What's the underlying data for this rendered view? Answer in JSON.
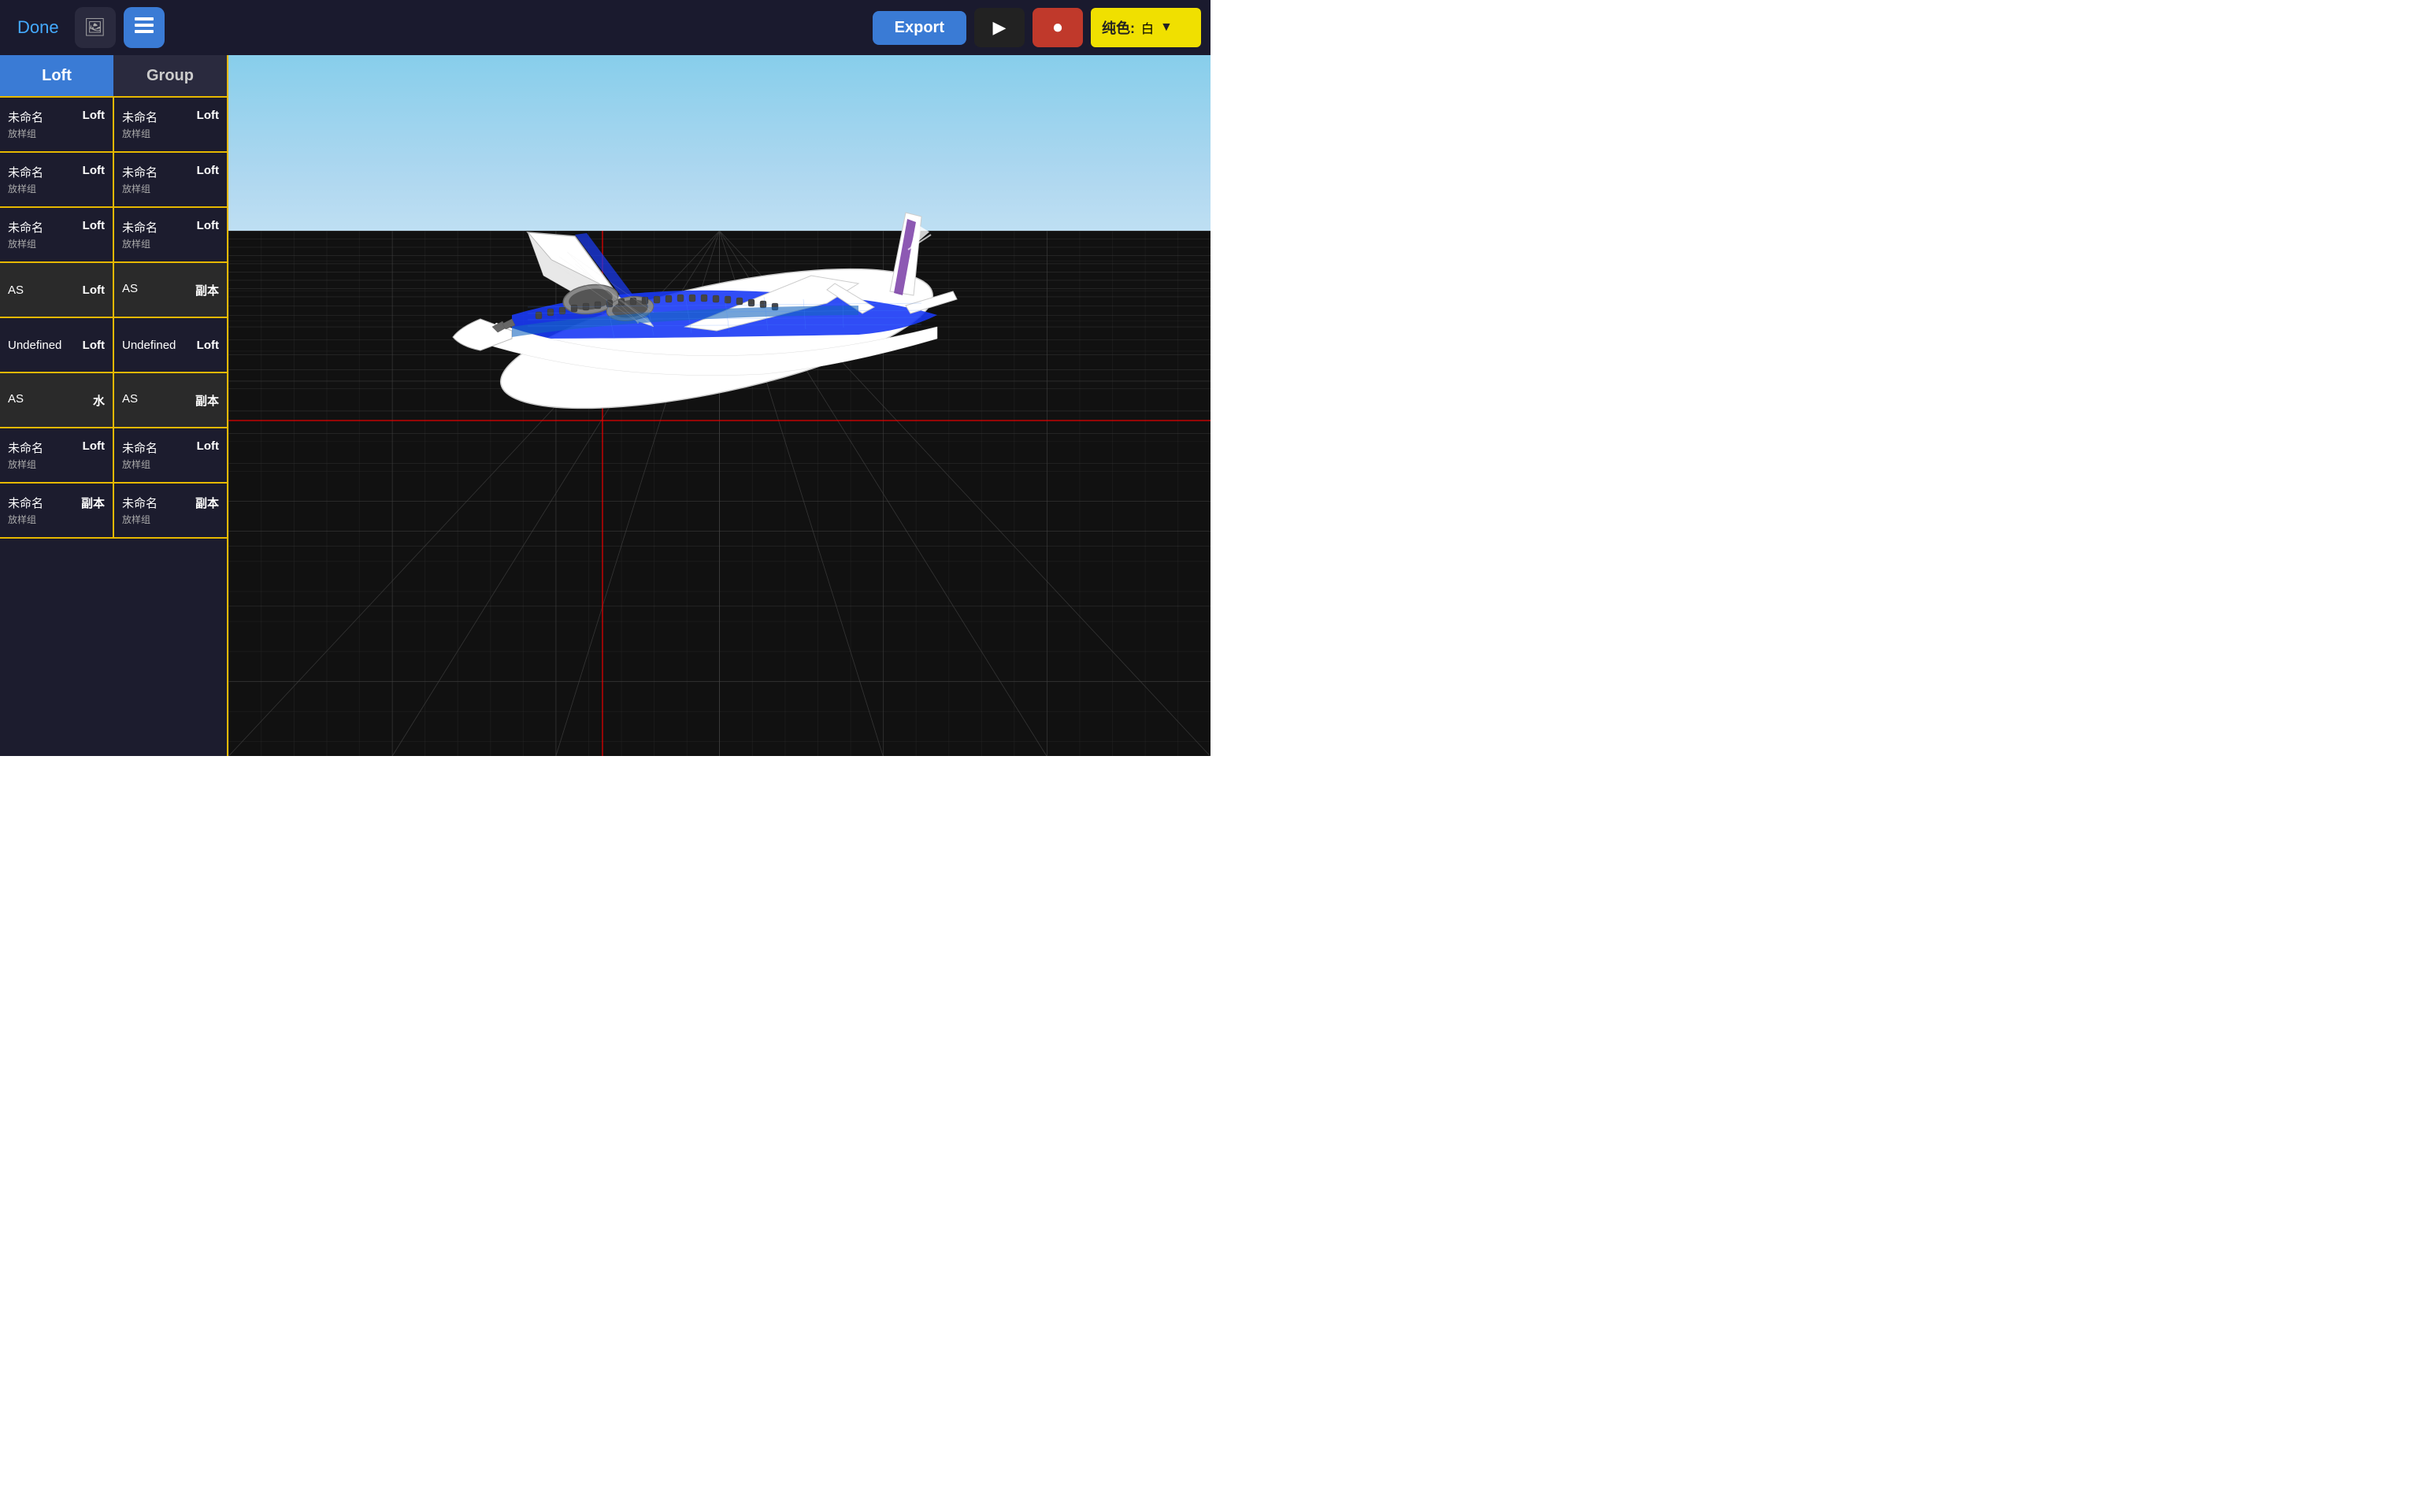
{
  "toolbar": {
    "done_label": "Done",
    "export_label": "Export",
    "color_label": "纯色:",
    "color_value": "白",
    "photo_icon": "🖼",
    "layers_icon": "◧",
    "play_icon": "▶",
    "record_icon": "⏺"
  },
  "sidebar": {
    "tab_loft": "Loft",
    "tab_group": "Group",
    "rows": [
      {
        "left_name": "未命名",
        "left_sub": "放样组",
        "left_type": "Loft",
        "right_name": "未命名",
        "right_sub": "放样组",
        "right_type": "Loft",
        "style": "default"
      },
      {
        "left_name": "未命名",
        "left_sub": "放样组",
        "left_type": "Loft",
        "right_name": "未命名",
        "right_sub": "放样组",
        "right_type": "Loft",
        "style": "default"
      },
      {
        "left_name": "未命名",
        "left_sub": "放样组",
        "left_type": "Loft",
        "right_name": "未命名",
        "right_sub": "放样组",
        "right_type": "Loft",
        "style": "default"
      },
      {
        "left_name": "AS",
        "left_sub": "",
        "left_type": "Loft",
        "right_name": "AS",
        "right_sub": "",
        "right_type": "副本",
        "style": "as"
      },
      {
        "left_name": "Undefined",
        "left_sub": "",
        "left_type": "Loft",
        "right_name": "Undefined",
        "right_sub": "",
        "right_type": "Loft",
        "style": "undef"
      },
      {
        "left_name": "AS",
        "left_sub": "",
        "left_type": "水",
        "right_name": "AS",
        "right_sub": "",
        "right_type": "副本",
        "style": "as"
      },
      {
        "left_name": "未命名",
        "left_sub": "放样组",
        "left_type": "Loft",
        "right_name": "未命名",
        "right_sub": "放样组",
        "right_type": "Loft",
        "style": "default"
      },
      {
        "left_name": "未命名",
        "left_sub": "放样组",
        "left_type": "副本",
        "right_name": "未命名",
        "right_sub": "放样组",
        "right_type": "副本",
        "style": "default"
      }
    ]
  }
}
